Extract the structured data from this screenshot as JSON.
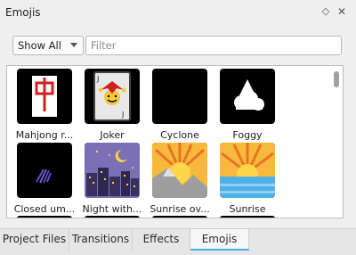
{
  "panel": {
    "title": "Emojis"
  },
  "filter": {
    "dropdown_value": "Show All",
    "placeholder": "Filter"
  },
  "items": [
    {
      "label": "Mahjong r...",
      "icon": "mahjong-tile-icon"
    },
    {
      "label": "Joker",
      "icon": "joker-card-icon"
    },
    {
      "label": "Cyclone",
      "icon": "cyclone-icon"
    },
    {
      "label": "Foggy",
      "icon": "foggy-icon"
    },
    {
      "label": "Closed um...",
      "icon": "closed-umbrella-icon"
    },
    {
      "label": "Night with...",
      "icon": "night-city-icon"
    },
    {
      "label": "Sunrise ov...",
      "icon": "sunrise-over-mountains-icon"
    },
    {
      "label": "Sunrise",
      "icon": "sunrise-icon"
    }
  ],
  "tabs": [
    {
      "label": "Project Files"
    },
    {
      "label": "Transitions"
    },
    {
      "label": "Effects"
    },
    {
      "label": "Emojis",
      "active": true
    }
  ],
  "colors": {
    "accent": "#3daee9"
  }
}
